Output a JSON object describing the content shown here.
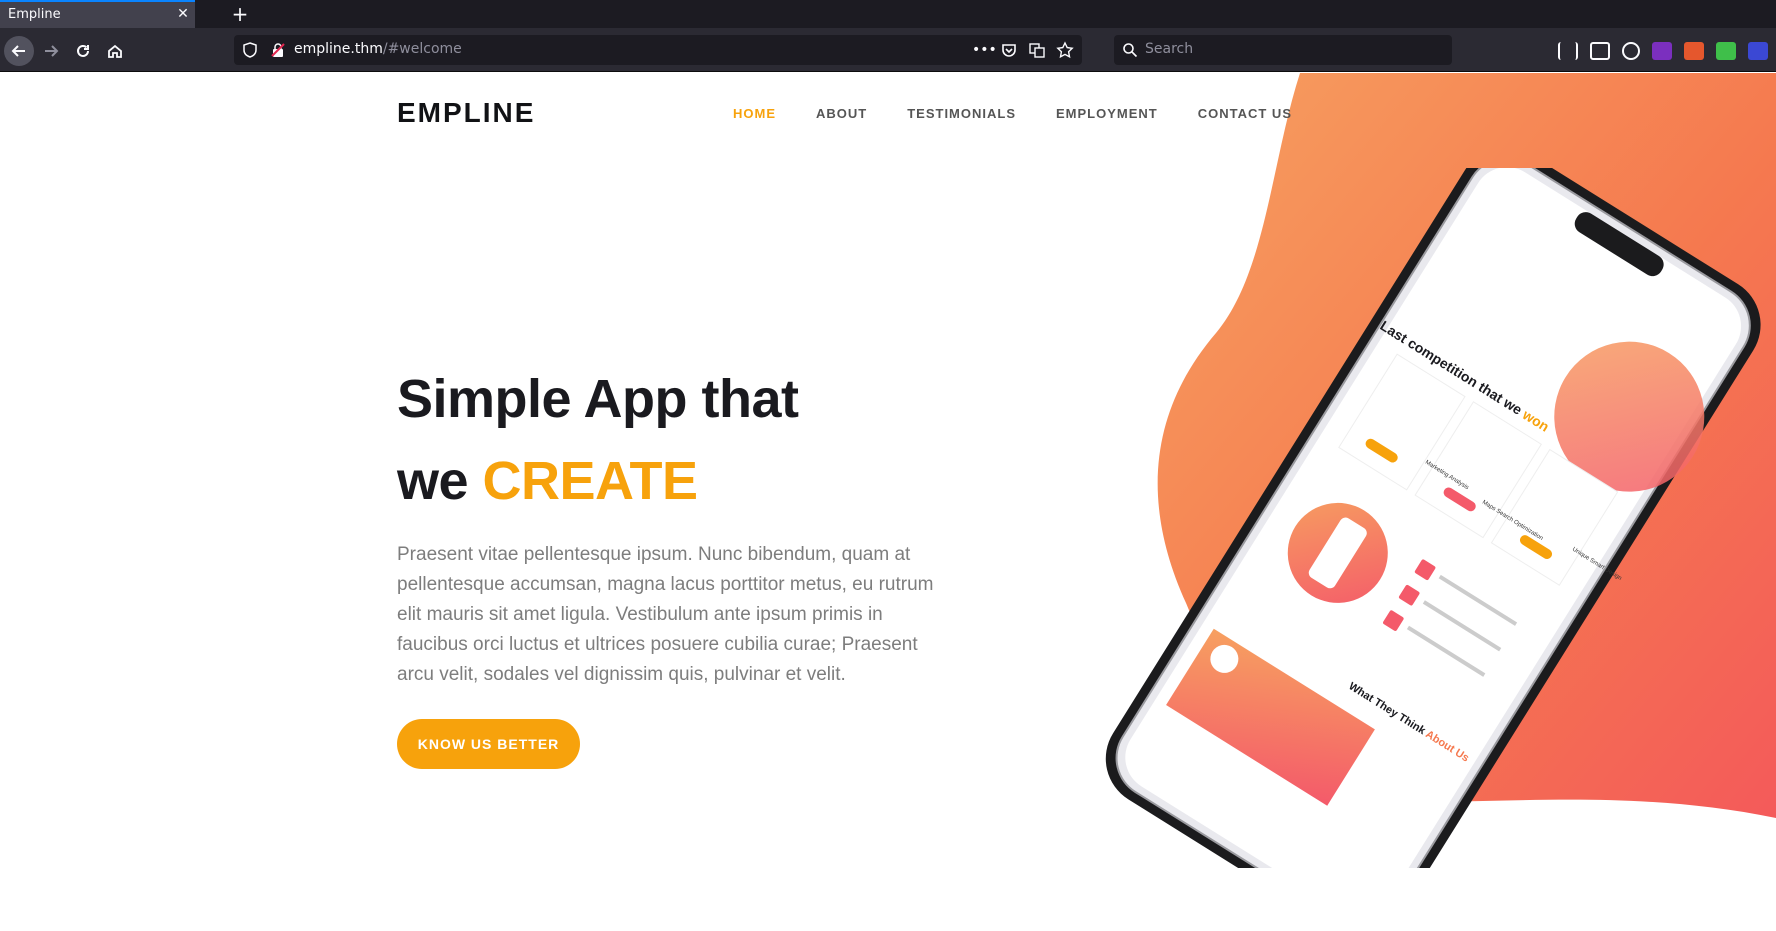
{
  "browser": {
    "tab_title": "Empline",
    "close_label": "✕",
    "newtab_label": "+",
    "url_host": "empline.thm",
    "url_path": "/#welcome",
    "url_more": "•••",
    "search_placeholder": "Search"
  },
  "site": {
    "logo": "EMPLINE",
    "menu": [
      {
        "label": "HOME"
      },
      {
        "label": "ABOUT"
      },
      {
        "label": "TESTIMONIALS"
      },
      {
        "label": "EMPLOYMENT"
      },
      {
        "label": "CONTACT US"
      }
    ],
    "hero": {
      "line1": "Simple App that",
      "line2_plain": "we ",
      "line2_accent": "CREATE",
      "paragraph": "Praesent vitae pellentesque ipsum. Nunc bibendum, quam at pellentesque accumsan, magna lacus porttitor metus, eu rutrum elit mauris sit amet ligula. Vestibulum ante ipsum primis in faucibus orci luctus et ultrices posuere cubilia curae; Praesent arcu velit, sodales vel dignissim quis, pulvinar et velit.",
      "cta": "KNOW US BETTER"
    },
    "phone_screen": {
      "heading_plain": "Last competition that we ",
      "heading_accent": "won",
      "feature_1": "Marketing Analysis",
      "feature_2": "Maps Search Optimization",
      "feature_3": "Unique Smart Design",
      "testimonial_plain": "What They Think ",
      "testimonial_accent": "About Us"
    },
    "colors": {
      "accent": "#f7a20c",
      "gradient_start": "#f7a060",
      "gradient_end": "#f45a5a",
      "heading": "#1a1a1f",
      "body_text": "#7d7d7d"
    }
  }
}
